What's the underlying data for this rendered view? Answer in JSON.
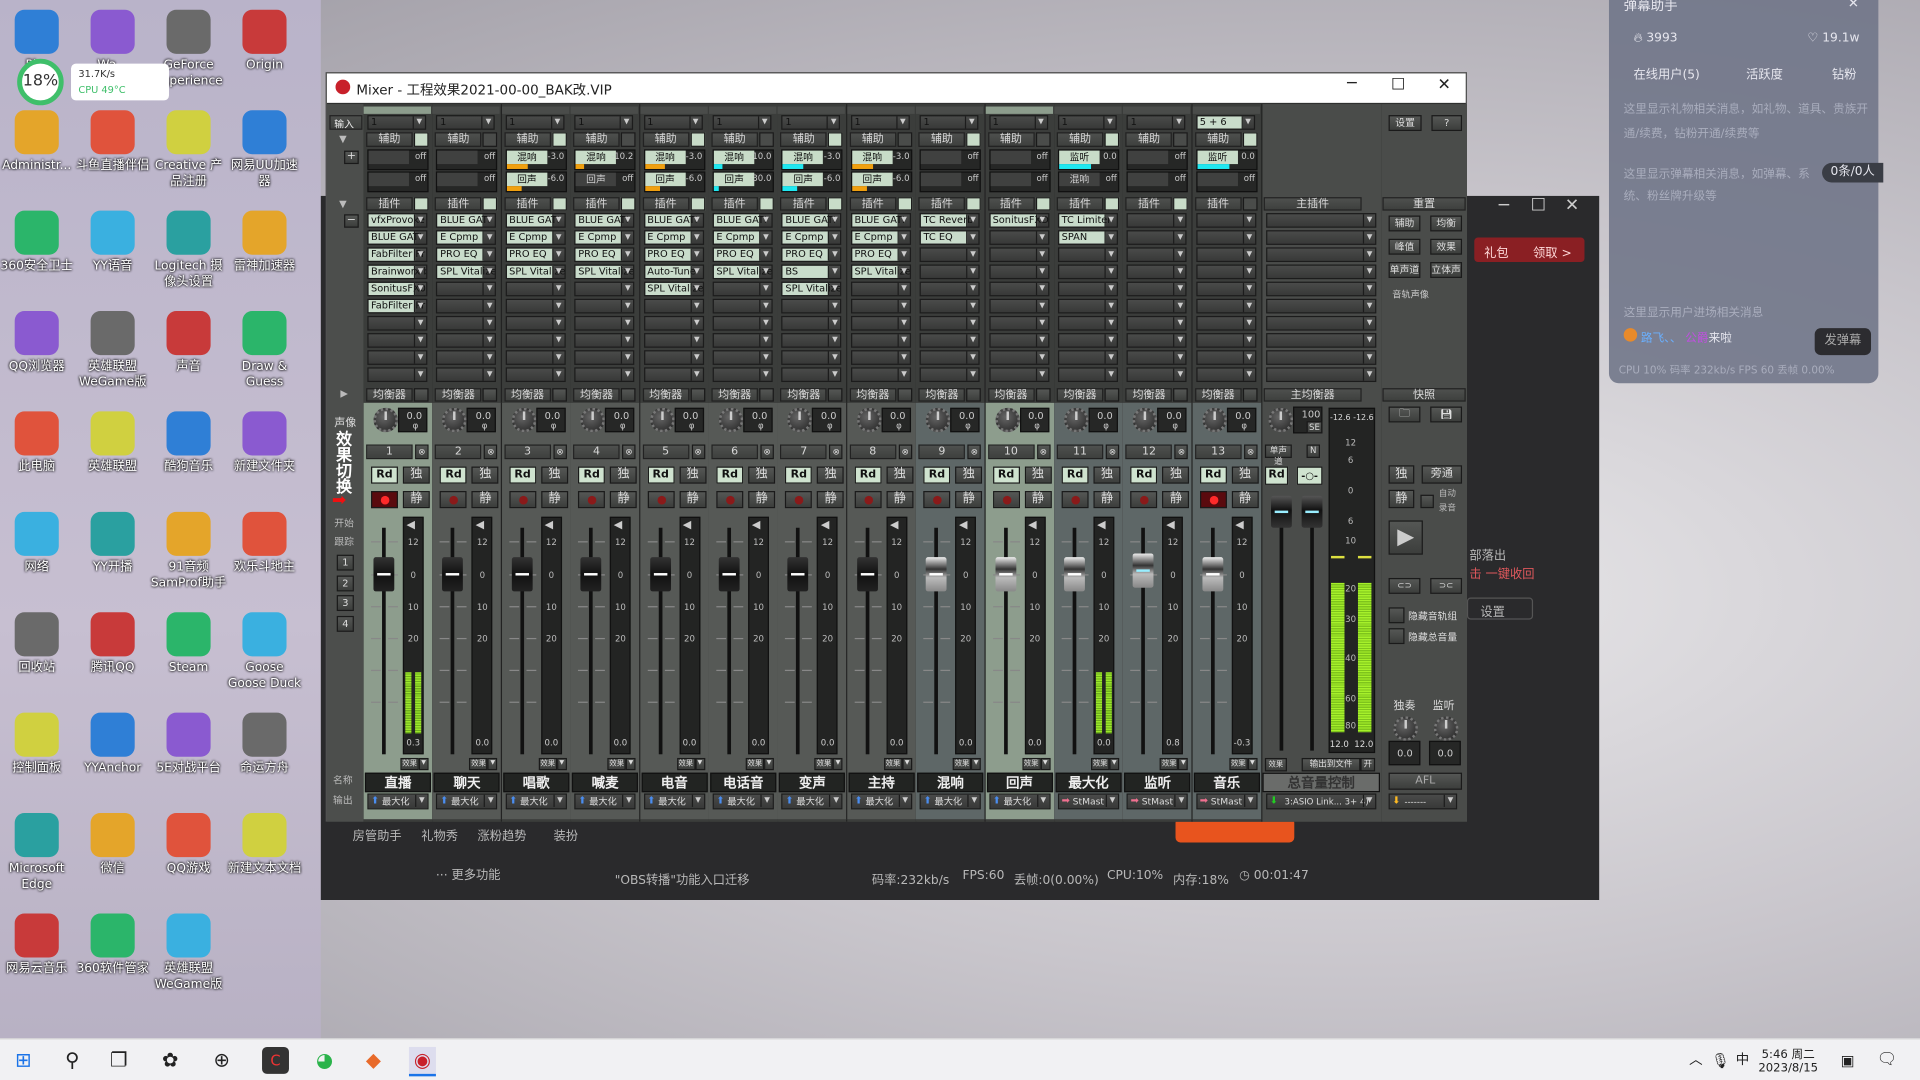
{
  "desktop": {
    "widget": {
      "percent": "18%",
      "speed": "31.7K/s",
      "cpu": "CPU 49°C"
    },
    "icons": [
      [
        "Pl...",
        "Administr...",
        "360安全卫士",
        "QQ浏览器",
        "此电脑",
        "网络",
        "回收站",
        "控制面板",
        "Microsoft Edge",
        "网易云音乐"
      ],
      [
        "Wa...",
        "斗鱼直播伴侣",
        "YY语音",
        "英雄联盟WeGame版",
        "英雄联盟",
        "YY开播",
        "腾讯QQ",
        "YYAnchor",
        "微信",
        "360软件管家"
      ],
      [
        "GeForce Experience",
        "Creative 产品注册",
        "Logitech 摄像头设置",
        "声音",
        "酷狗音乐",
        "91音频 SamProf助手",
        "Steam",
        "5E对战平台",
        "QQ游戏",
        "英雄联盟WeGame版"
      ],
      [
        "Origin",
        "网易UU加速器",
        "雷神加速器",
        "Draw & Guess",
        "新建文件夹",
        "欢乐斗地主",
        "Goose Goose Duck",
        "命运方舟",
        "新建文本文档",
        ""
      ]
    ],
    "badge_360": "15"
  },
  "stream_app": {
    "gift_button": "礼包",
    "claim_button": "领取 >",
    "tools": [
      "房管助手",
      "礼物秀",
      "涨粉趋势",
      "装扮"
    ],
    "more": "··· 更多功能",
    "notice": "\"OBS转播\"功能入口迁移",
    "status": {
      "bitrate": "码率:232kb/s",
      "fps": "FPS:60",
      "drop": "丢帧:0(0.00%)",
      "cpu": "CPU:10%",
      "mem": "内存:18%",
      "time": "00:01:47"
    },
    "side_text1": "部落出",
    "side_text2": "击 一键收回",
    "settings": "设置"
  },
  "danmu": {
    "title": "弹幕助手",
    "fire": "3993",
    "likes": "19.1w",
    "tabs": [
      "在线用户(5)",
      "活跃度",
      "钻粉"
    ],
    "gift_hint": "这里显示礼物相关消息，如礼物、道具、贵族开通/续费，钻粉开通/续费等",
    "danmu_hint": "这里显示弹幕相关消息，如弹幕、系统、粉丝牌升级等",
    "count_badge": "0条/0人",
    "enter_hint": "这里显示用户进场相关消息",
    "enter_user": "路飞、、",
    "enter_suffix": "来啦",
    "enter_mid": "公爵",
    "send_button": "发弹幕",
    "stats": "CPU 10%  码率 232kb/s  FPS 60  丢帧 0.00%"
  },
  "mixer": {
    "title": "Mixer - 工程效果2021-00-00_BAK改.VIP",
    "left": {
      "input": "输入",
      "pan": "声像",
      "fx_switch": "效果切换",
      "start": "开始",
      "track": "跟踪",
      "groups": [
        "1",
        "2",
        "3",
        "4"
      ],
      "name": "名称",
      "output": "输出"
    },
    "labels": {
      "aux": "辅助",
      "plugin": "插件",
      "eq": "均衡器",
      "fx": "效果",
      "rd": "Rd",
      "solo": "独",
      "mute": "静"
    },
    "meter_scale": [
      "12",
      "0",
      "10",
      "20"
    ],
    "channels": [
      {
        "num": "1",
        "name": "直播",
        "input": "1",
        "pan": "0.0",
        "rec": true,
        "hl": true,
        "fader_db": 0,
        "meter_db": -30,
        "peak": "0.3",
        "fader_style": "dark",
        "output": "最大化",
        "out_color": "#4a8df0",
        "sends": [
          {
            "label": "",
            "value": "off"
          },
          {
            "label": "",
            "value": "off"
          }
        ],
        "plugins": [
          "vfxProvoke",
          "BLUE GATI",
          "FabFilter Pr",
          "Brainworx b",
          "SonitusFX0",
          "FabFilter Pr"
        ]
      },
      {
        "num": "2",
        "name": "聊天",
        "input": "1",
        "pan": "0.0",
        "rec": false,
        "fader_db": 0,
        "peak": "0.0",
        "fader_style": "dark",
        "output": "最大化",
        "out_color": "#4a8df0",
        "sends": [
          {
            "label": "",
            "value": "off"
          },
          {
            "label": "",
            "value": "off"
          }
        ],
        "plugins": [
          "BLUE GATI",
          "E Cpmp",
          "PRO EQ",
          "SPL Vitalize"
        ]
      },
      {
        "num": "3",
        "name": "唱歌",
        "input": "1",
        "pan": "0.0",
        "rec": false,
        "fader_db": 0,
        "peak": "0.0",
        "fader_style": "dark",
        "output": "最大化",
        "out_color": "#4a8df0",
        "sends": [
          {
            "label": "混响",
            "value": "-3.0",
            "level": 0.35,
            "color": "#f0a010"
          },
          {
            "label": "回声",
            "value": "-6.0",
            "level": 0.25,
            "color": "#f0a010"
          }
        ],
        "plugins": [
          "BLUE GATI",
          "E Cpmp",
          "PRO EQ",
          "SPL Vitalize"
        ]
      },
      {
        "num": "4",
        "name": "喊麦",
        "input": "1",
        "pan": "0.0",
        "rec": false,
        "fader_db": 0,
        "peak": "0.0",
        "fader_style": "dark",
        "output": "最大化",
        "out_color": "#4a8df0",
        "sends": [
          {
            "label": "混响",
            "value": "-10.2",
            "level": 0.15,
            "color": "#f0a010"
          },
          {
            "label": "回声",
            "value": "off"
          }
        ],
        "plugins": [
          "BLUE GATI",
          "E Cpmp",
          "PRO EQ",
          "SPL Vitalize"
        ]
      },
      {
        "num": "5",
        "name": "电音",
        "input": "1",
        "pan": "0.0",
        "rec": false,
        "fader_db": 0,
        "peak": "0.0",
        "fader_style": "dark",
        "output": "最大化",
        "out_color": "#4a8df0",
        "sends": [
          {
            "label": "混响",
            "value": "-3.0",
            "level": 0.35,
            "color": "#f0a010"
          },
          {
            "label": "回声",
            "value": "-6.0",
            "level": 0.25,
            "color": "#f0a010"
          }
        ],
        "plugins": [
          "BLUE GATI",
          "E Cpmp",
          "PRO EQ",
          "Auto-Tune",
          "SPL Vitalize"
        ]
      },
      {
        "num": "6",
        "name": "电话音",
        "input": "1",
        "pan": "0.0",
        "rec": false,
        "fader_db": 0,
        "peak": "0.0",
        "fader_style": "dark",
        "output": "最大化",
        "out_color": "#4a8df0",
        "sends": [
          {
            "label": "混响",
            "value": "-10.0",
            "level": 0.15,
            "color": "#20e8f0"
          },
          {
            "label": "回声",
            "value": "-30.0",
            "level": 0.08,
            "color": "#20e8f0"
          }
        ],
        "plugins": [
          "BLUE GATI",
          "E Cpmp",
          "PRO EQ",
          "SPL Vitalize"
        ]
      },
      {
        "num": "7",
        "name": "变声",
        "input": "1",
        "pan": "0.0",
        "rec": false,
        "fader_db": 0,
        "peak": "0.0",
        "fader_style": "dark",
        "output": "最大化",
        "out_color": "#4a8df0",
        "sends": [
          {
            "label": "混响",
            "value": "-3.0",
            "level": 0.35,
            "color": "#20e8f0"
          },
          {
            "label": "回声",
            "value": "-6.0",
            "level": 0.25,
            "color": "#20e8f0"
          }
        ],
        "plugins": [
          "BLUE GATI",
          "E Cpmp",
          "PRO EQ",
          "BS",
          "SPL Vitalize"
        ]
      },
      {
        "num": "8",
        "name": "主持",
        "input": "1",
        "pan": "0.0",
        "rec": false,
        "fader_db": 0,
        "peak": "0.0",
        "fader_style": "dark",
        "output": "最大化",
        "out_color": "#4a8df0",
        "sends": [
          {
            "label": "混响",
            "value": "-3.0",
            "level": 0.35,
            "color": "#f0a010"
          },
          {
            "label": "回声",
            "value": "-6.0",
            "level": 0.25,
            "color": "#f0a010"
          }
        ],
        "plugins": [
          "BLUE GATI",
          "E Cpmp",
          "PRO EQ",
          "SPL Vitalize"
        ]
      },
      {
        "num": "9",
        "name": "混响",
        "input": "1",
        "pan": "0.0",
        "rec": false,
        "fader_db": 0,
        "peak": "0.0",
        "fader_style": "silver",
        "output": "最大化",
        "out_color": "#4a8df0",
        "sends": [
          {
            "label": "",
            "value": "off"
          },
          {
            "label": "",
            "value": "off"
          }
        ],
        "plugins": [
          "TC Reverb",
          "TC EQ"
        ]
      },
      {
        "num": "10",
        "name": "回声",
        "input": "1",
        "pan": "0.0",
        "rec": false,
        "hl": true,
        "fader_db": 0,
        "peak": "0.0",
        "fader_style": "silver",
        "output": "最大化",
        "out_color": "#4a8df0",
        "sends": [
          {
            "label": "",
            "value": "off"
          },
          {
            "label": "",
            "value": "off"
          }
        ],
        "plugins": [
          "SonitusFXD"
        ]
      },
      {
        "num": "11",
        "name": "最大化",
        "input": "1",
        "pan": "0.0",
        "rec": false,
        "fader_db": 0,
        "meter_db": -30,
        "peak": "0.0",
        "fader_style": "silver",
        "output": "StMast",
        "out_color": "#f07090",
        "sends": [
          {
            "label": "监听",
            "value": "0.0",
            "level": 0.55,
            "color": "#20e8f0"
          },
          {
            "label": "混响",
            "value": "off"
          }
        ],
        "plugins": [
          "TC Limiter",
          "SPAN"
        ]
      },
      {
        "num": "12",
        "name": "监听",
        "input": "1",
        "pan": "0.0",
        "rec": false,
        "fader_db": 1,
        "peak": "0.8",
        "fader_style": "silver",
        "output": "StMast",
        "out_color": "#f07090",
        "sends": [
          {
            "label": "",
            "value": "off"
          },
          {
            "label": "",
            "value": "off"
          }
        ],
        "plugins": []
      },
      {
        "num": "13",
        "name": "音乐",
        "input": "5 + 6",
        "pan": "0.0",
        "rec": true,
        "fader_db": 0,
        "peak": "-0.3",
        "fader_style": "silver",
        "output": "StMast",
        "out_color": "#f07090",
        "sends": [
          {
            "label": "监听",
            "value": "0.0",
            "level": 0.55,
            "color": "#20e8f0"
          },
          {
            "label": "",
            "value": "off"
          }
        ],
        "plugins": []
      }
    ],
    "master": {
      "plugin_header": "主插件",
      "eq_header": "主均衡器",
      "volume": "100",
      "se": "SE",
      "mono": "单声道",
      "n": "N",
      "rd": "Rd",
      "meter_readout": "-12.6 -12.6",
      "meter_db": -18,
      "peak_db": -12.6,
      "scale": [
        "12",
        "6",
        "0",
        "6",
        "10",
        "20",
        "30",
        "40",
        "60",
        "80"
      ],
      "bottom_left": "12.0",
      "bottom_right": "12.0",
      "fx": "效果",
      "to_file": "输出到文件",
      "on": "开",
      "name": "总音量控制",
      "output": "3:ASIO Link... 3+ 4)"
    },
    "side": {
      "settings": "设置",
      "help": "?",
      "reset": "重置",
      "buttons": [
        "辅助",
        "均衡",
        "峰值",
        "效果",
        "单声道",
        "立体声"
      ],
      "pan_label": "音轨声像",
      "snapshot": "快照",
      "solo": "独",
      "bypass": "旁通",
      "mute": "静",
      "auto": "自动",
      "rec": "录音",
      "hide_groups": "隐藏音轨组",
      "hide_master": "隐藏总音量",
      "solo_knob": "独奏",
      "monitor_knob": "监听",
      "solo_val": "0.0",
      "monitor_val": "0.0",
      "afl": "AFL",
      "output": "-------"
    }
  },
  "taskbar": {
    "time": "5:46 周二",
    "date": "2023/8/15",
    "ime": "中"
  }
}
